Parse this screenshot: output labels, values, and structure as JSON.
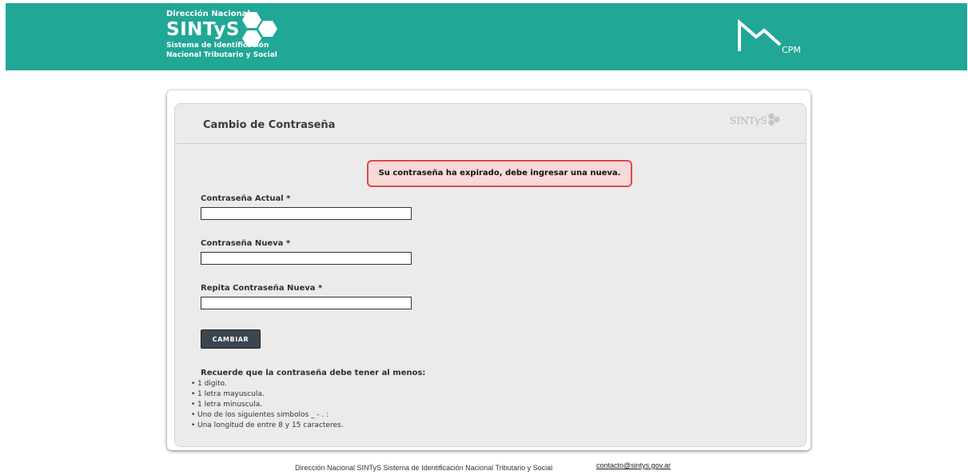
{
  "header": {
    "org_line": "Dirección Nacional",
    "brand_name": "SINTyS",
    "sub_line_1": "Sistema de Identificación",
    "sub_line_2": "Nacional Tributario y Social",
    "cpm_label": "CPM",
    "banner_color": "#21a796"
  },
  "form": {
    "title": "Cambio de Contraseña",
    "mini_logo_top": "Dirección Nacional",
    "mini_logo_name": "SINTyS",
    "mini_logo_sub": "Sistema de Identificación Nacional Tributario y Social",
    "alert": "Su contraseña ha expirado, debe ingresar una nueva.",
    "fields": [
      {
        "label": "Contraseña Actual *",
        "value": "",
        "placeholder": ""
      },
      {
        "label": "Contraseña Nueva *",
        "value": "",
        "placeholder": ""
      },
      {
        "label": "Repita Contraseña Nueva *",
        "value": "",
        "placeholder": ""
      }
    ],
    "submit_label": "CAMBIAR"
  },
  "rules": {
    "title": "Recuerde que la contraseña debe tener al menos:",
    "items": [
      "1 digito.",
      "1 letra mayuscula.",
      "1 letra minuscula.",
      "Uno de los siguientes simbolos _ - . :",
      "Una longitud de entre 8 y 15 caracteres."
    ]
  },
  "footer": {
    "text": "Dirección Nacional SINTyS Sistema de Identificación Nacional Tributario y Social",
    "email": "contacto@sintys.gov.ar"
  }
}
